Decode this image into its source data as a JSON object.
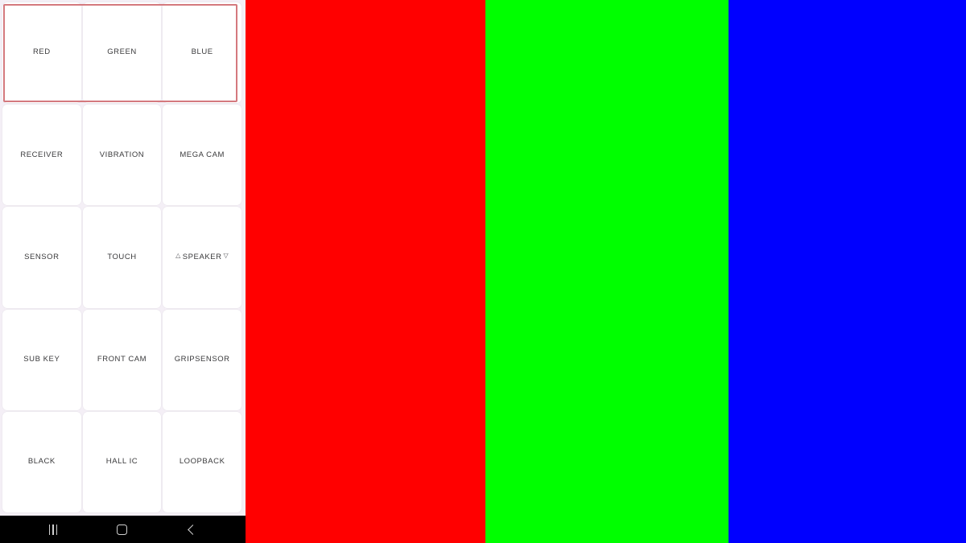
{
  "screen": {
    "title": "Device Factory Test Grid",
    "background_color": "#f4eff6"
  },
  "highlight": {
    "target": "row-1",
    "border_color": "#d4797e",
    "label": "selected-row-highlight"
  },
  "grid": {
    "columns": 3,
    "rows": 5,
    "cells": [
      {
        "label": "RED",
        "name": "grid-cell-red"
      },
      {
        "label": "GREEN",
        "name": "grid-cell-green"
      },
      {
        "label": "BLUE",
        "name": "grid-cell-blue"
      },
      {
        "label": "RECEIVER",
        "name": "grid-cell-receiver"
      },
      {
        "label": "VIBRATION",
        "name": "grid-cell-vibration"
      },
      {
        "label": "MEGA CAM",
        "name": "grid-cell-mega-cam"
      },
      {
        "label": "SENSOR",
        "name": "grid-cell-sensor"
      },
      {
        "label": "TOUCH",
        "name": "grid-cell-touch"
      },
      {
        "label": "SPEAKER",
        "name": "grid-cell-speaker",
        "prefix_icon": "triangle-up-icon",
        "suffix_icon": "triangle-down-icon",
        "prefix_glyph": "△",
        "suffix_glyph": "▽"
      },
      {
        "label": "SUB KEY",
        "name": "grid-cell-sub-key"
      },
      {
        "label": "FRONT CAM",
        "name": "grid-cell-front-cam"
      },
      {
        "label": "GRIPSENSOR",
        "name": "grid-cell-gripsensor"
      },
      {
        "label": "BLACK",
        "name": "grid-cell-black"
      },
      {
        "label": "HALL IC",
        "name": "grid-cell-hall-ic"
      },
      {
        "label": "LOOPBACK",
        "name": "grid-cell-loopback"
      }
    ]
  },
  "color_bands": [
    {
      "name": "red-color-band",
      "color": "#ff0000",
      "label": "RED"
    },
    {
      "name": "green-color-band",
      "color": "#00ff00",
      "label": "GREEN"
    },
    {
      "name": "blue-color-band",
      "color": "#0000ff",
      "label": "BLUE"
    }
  ],
  "nav_bar": {
    "background_color": "#000000",
    "buttons": [
      {
        "name": "recents-icon",
        "label": "Recents"
      },
      {
        "name": "home-icon",
        "label": "Home"
      },
      {
        "name": "back-icon",
        "label": "Back"
      }
    ]
  }
}
